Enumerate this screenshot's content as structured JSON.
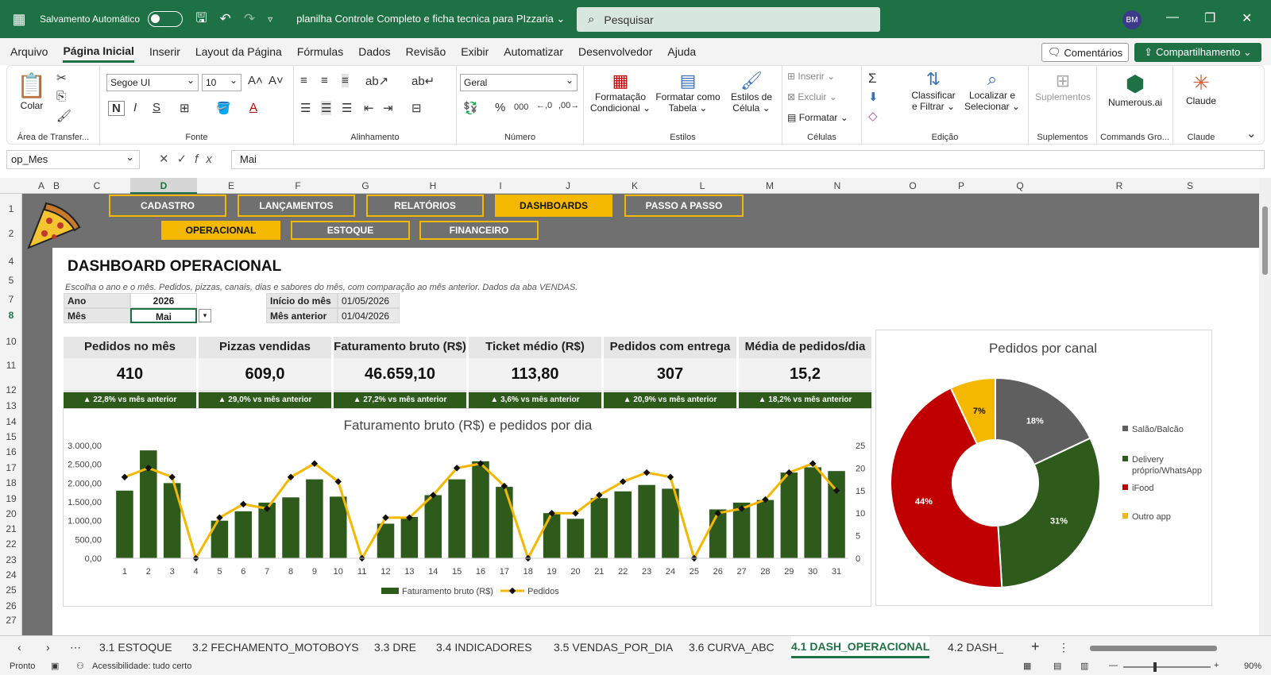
{
  "titlebar": {
    "autosave_label": "Salvamento Automático",
    "filename": "planilha Controle Completo e ficha tecnica para PIzzaria ⌄",
    "search_placeholder": "Pesquisar",
    "user_initials": "BM"
  },
  "ribbon_tabs": [
    "Arquivo",
    "Página Inicial",
    "Inserir",
    "Layout da Página",
    "Fórmulas",
    "Dados",
    "Revisão",
    "Exibir",
    "Automatizar",
    "Desenvolvedor",
    "Ajuda"
  ],
  "ribbon_actions": {
    "comments": "Comentários",
    "share": "Compartilhamento ⌄"
  },
  "ribbon": {
    "paste_label": "Colar",
    "clipboard_group": "Área de Transfer...",
    "font_name": "Segoe UI",
    "font_size": "10",
    "font_group": "Fonte",
    "align_group": "Alinhamento",
    "number_format": "Geral",
    "number_group": "Número",
    "cond_format": "Formatação Condicional ⌄",
    "format_table": "Formatar como Tabela ⌄",
    "cell_styles": "Estilos de Célula ⌄",
    "styles_group": "Estilos",
    "insert": "Inserir",
    "delete": "Excluir",
    "format": "Formatar",
    "cells_group": "Células",
    "sort_filter": "Classificar e Filtrar ⌄",
    "find_select": "Localizar e Selecionar ⌄",
    "edit_group": "Edição",
    "addins": "Suplementos",
    "addins_group": "Suplementos",
    "numerous": "Numerous.ai",
    "commands_group": "Commands Gro...",
    "claude": "Claude",
    "claude_group": "Claude"
  },
  "formula_bar": {
    "name_box": "op_Mes",
    "value": "Mai"
  },
  "columns": [
    "A",
    "B",
    "C",
    "D",
    "E",
    "F",
    "G",
    "H",
    "I",
    "J",
    "K",
    "L",
    "M",
    "N",
    "O",
    "P",
    "Q",
    "R",
    "S"
  ],
  "rows": [
    "1",
    "2",
    "4",
    "5",
    "7",
    "8",
    "10",
    "11",
    "12",
    "13",
    "14",
    "15",
    "16",
    "17",
    "18",
    "19",
    "20",
    "21",
    "22",
    "23",
    "24",
    "25",
    "26",
    "27"
  ],
  "nav": {
    "main": [
      "CADASTRO",
      "LANÇAMENTOS",
      "RELATÓRIOS",
      "DASHBOARDS",
      "PASSO A PASSO"
    ],
    "sub": [
      "OPERACIONAL",
      "ESTOQUE",
      "FINANCEIRO"
    ]
  },
  "dashboard": {
    "title": "DASHBOARD OPERACIONAL",
    "subtitle": "Escolha o ano e o mês. Pedidos, pizzas, canais, dias e sabores do mês, com comparação ao mês anterior. Dados da aba VENDAS.",
    "ano_label": "Ano",
    "ano_value": "2026",
    "mes_label": "Mês",
    "mes_value": "Mai",
    "inicio_label": "Início do mês",
    "inicio_value": "01/05/2026",
    "anterior_label": "Mês anterior",
    "anterior_value": "01/04/2026"
  },
  "kpis": [
    {
      "label": "Pedidos no mês",
      "value": "410",
      "delta": "▲ 22,8% vs mês anterior"
    },
    {
      "label": "Pizzas vendidas",
      "value": "609,0",
      "delta": "▲ 29,0% vs mês anterior"
    },
    {
      "label": "Faturamento bruto (R$)",
      "value": "46.659,10",
      "delta": "▲ 27,2% vs mês anterior"
    },
    {
      "label": "Ticket médio (R$)",
      "value": "113,80",
      "delta": "▲ 3,6% vs mês anterior"
    },
    {
      "label": "Pedidos com entrega",
      "value": "307",
      "delta": "▲ 20,9% vs mês anterior"
    },
    {
      "label": "Média de pedidos/dia",
      "value": "15,2",
      "delta": "▲ 18,2% vs mês anterior"
    }
  ],
  "colors": {
    "excel_green": "#1e7145",
    "bar_green": "#2e5a1c",
    "line_yellow": "#f5b800",
    "gray_slice": "#5f5f5f",
    "red_slice": "#c00000"
  },
  "chart_data": [
    {
      "type": "bar",
      "title": "Faturamento bruto (R$) e pedidos por dia",
      "categories": [
        "1",
        "2",
        "3",
        "4",
        "5",
        "6",
        "7",
        "8",
        "9",
        "10",
        "11",
        "12",
        "13",
        "14",
        "15",
        "16",
        "17",
        "18",
        "19",
        "20",
        "21",
        "22",
        "23",
        "24",
        "25",
        "26",
        "27",
        "28",
        "29",
        "30",
        "31"
      ],
      "series": [
        {
          "name": "Faturamento bruto (R$)",
          "type": "bar",
          "axis": "left",
          "values": [
            1800,
            2870,
            2000,
            0,
            1000,
            1250,
            1480,
            1620,
            2100,
            1640,
            0,
            920,
            1100,
            1680,
            2100,
            2580,
            1900,
            0,
            1200,
            1050,
            1600,
            1780,
            1950,
            1850,
            0,
            1300,
            1480,
            1550,
            2280,
            2420,
            2320
          ]
        },
        {
          "name": "Pedidos",
          "type": "line",
          "axis": "right",
          "values": [
            18,
            20,
            18,
            0,
            9,
            12,
            11,
            18,
            21,
            17,
            0,
            9,
            9,
            14,
            20,
            21,
            16,
            0,
            10,
            10,
            14,
            17,
            19,
            18,
            0,
            10,
            11,
            13,
            19,
            21,
            15
          ]
        }
      ],
      "y_left_ticks": [
        "3.000,00",
        "2.500,00",
        "2.000,00",
        "1.500,00",
        "1.000,00",
        "500,00",
        "0,00"
      ],
      "ylim_left": [
        0,
        3000
      ],
      "y_right_ticks": [
        "25",
        "20",
        "15",
        "10",
        "5",
        "0"
      ],
      "ylim_right": [
        0,
        25
      ],
      "legend_position": "bottom"
    },
    {
      "type": "pie",
      "title": "Pedidos por canal",
      "donut": true,
      "labels": [
        "Salão/Balcão",
        "Delivery próprio/WhatsApp",
        "iFood",
        "Outro app"
      ],
      "values": [
        18,
        31,
        44,
        7
      ],
      "value_labels": [
        "18%",
        "31%",
        "44%",
        "7%"
      ],
      "colors": [
        "#5f5f5f",
        "#2e5a1c",
        "#c00000",
        "#f5b800"
      ],
      "legend_position": "right"
    }
  ],
  "sheet_tabs": [
    "3.1 ESTOQUE",
    "3.2 FECHAMENTO_MOTOBOYS",
    "3.3 DRE",
    "3.4 INDICADORES",
    "3.5 VENDAS_POR_DIA",
    "3.6 CURVA_ABC",
    "4.1 DASH_OPERACIONAL",
    "4.2 DASH_"
  ],
  "status": {
    "ready": "Pronto",
    "accessibility": "Acessibilidade: tudo certo",
    "zoom": "90%"
  }
}
